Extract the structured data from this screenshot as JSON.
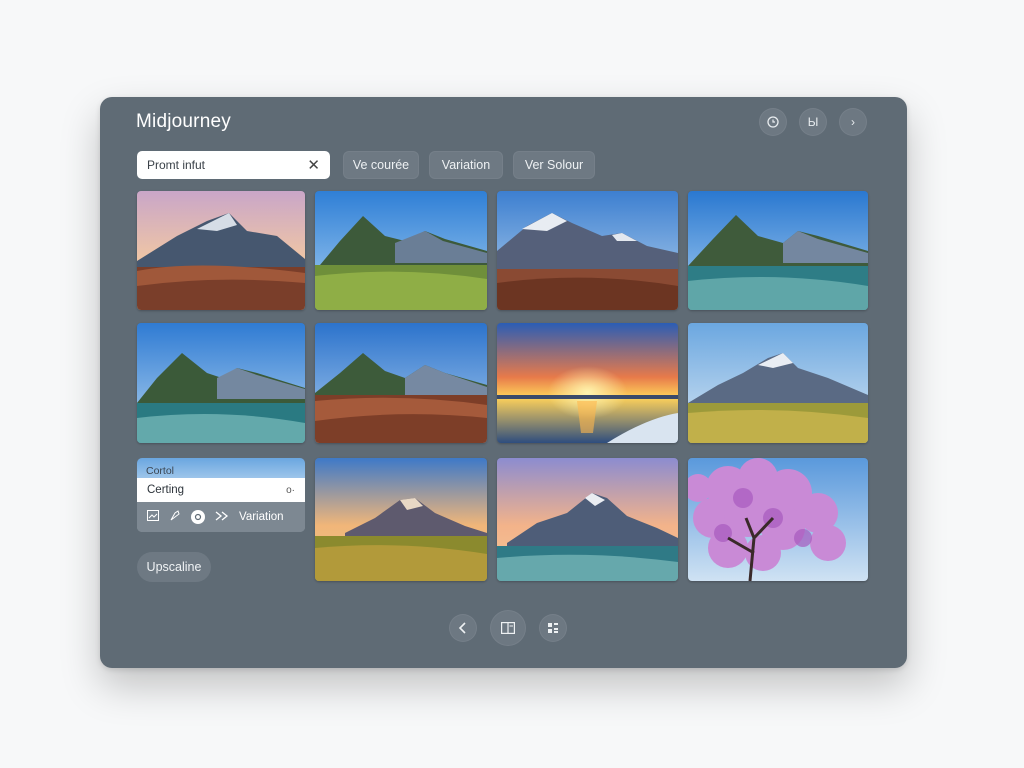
{
  "app": {
    "title": "Midjourney"
  },
  "header_actions": [
    {
      "icon": "clock-icon"
    },
    {
      "icon": "chart-icon",
      "label": "Ы"
    },
    {
      "icon": "chevron-right-icon",
      "label": "›"
    }
  ],
  "prompt": {
    "placeholder": "Promt infut",
    "clear_label": "✕"
  },
  "chips": [
    "Ve courée",
    "Variation",
    "Ver Solour"
  ],
  "panel": {
    "label": "Cortol",
    "field_value": "Certing",
    "field_icon": "o·",
    "tools_action": "Variation",
    "tool_icons": [
      "image-icon",
      "paint-icon",
      "info-icon",
      "forward-icon"
    ]
  },
  "upscale_label": "Upscaline",
  "grid": {
    "tiles": [
      {
        "scene": "mountain-dusk"
      },
      {
        "scene": "mountain-green"
      },
      {
        "scene": "mountain-snow"
      },
      {
        "scene": "mountain-lake"
      },
      {
        "scene": "mountain-lake"
      },
      {
        "scene": "mountain-brown"
      },
      {
        "scene": "sunset-lake"
      },
      {
        "scene": "mountain-meadow"
      },
      {
        "scene": "mountain-golden"
      },
      {
        "scene": "mountain-alpenglow"
      },
      {
        "scene": "blossom-tree"
      }
    ]
  },
  "pagination": {
    "prev_icon": "chevron-left-icon",
    "center_icon": "layout-icon",
    "grid_icon": "grid-icon"
  },
  "colors": {
    "window_bg": "#5f6b75",
    "chip_bg": "#6e7983",
    "page_bg": "#f7f8f9"
  }
}
